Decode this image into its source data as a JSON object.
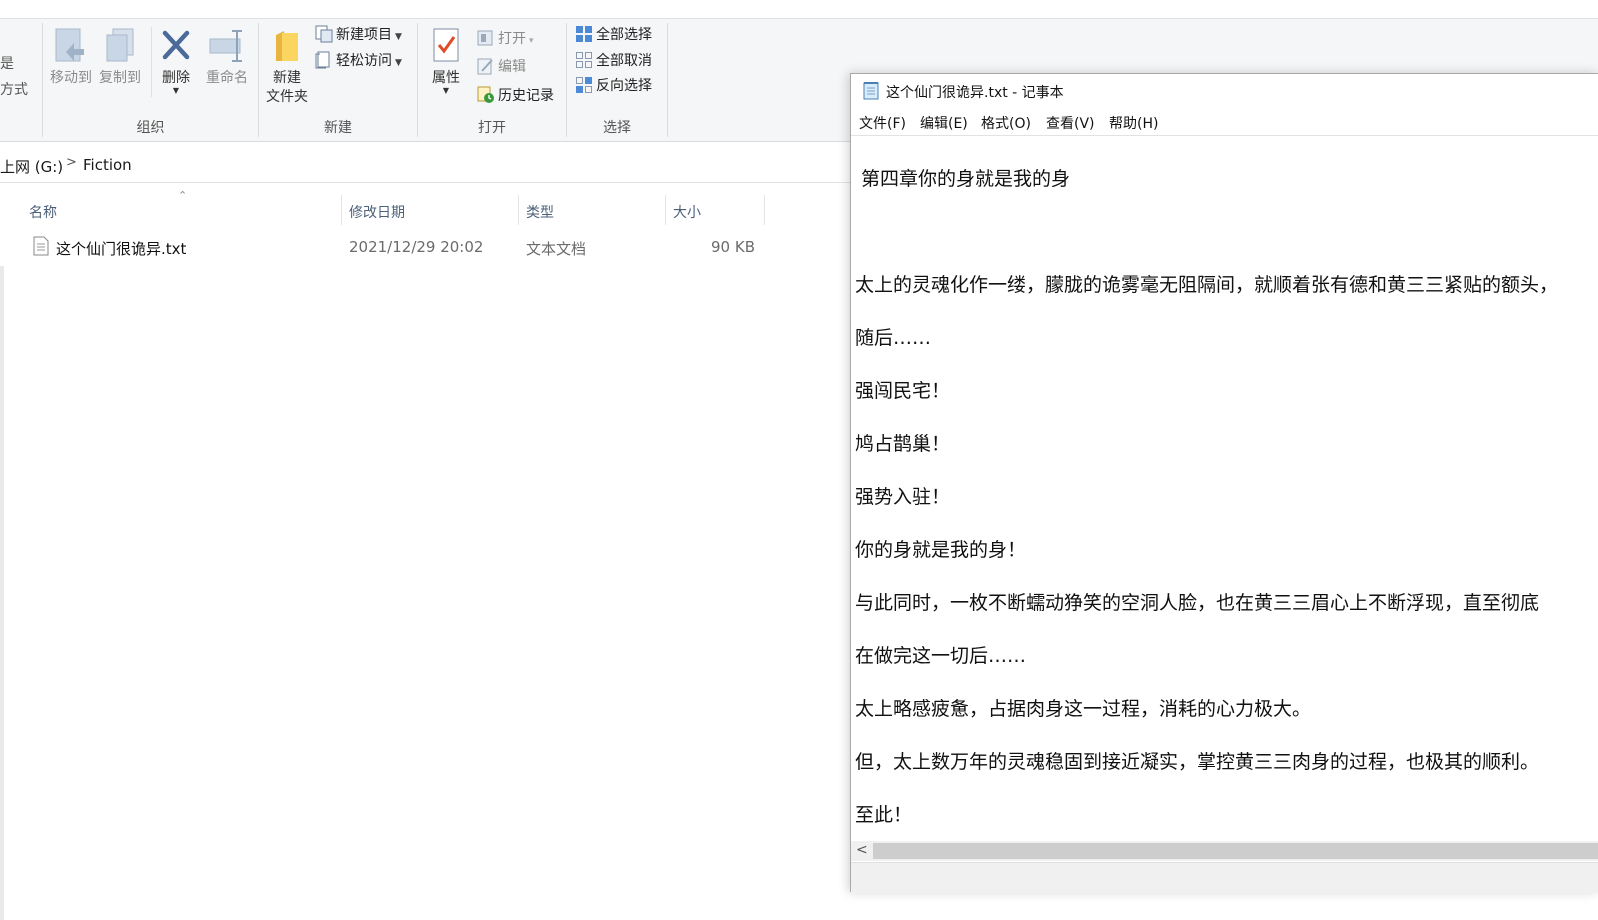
{
  "ribbon": {
    "left_partial_top": "是",
    "left_partial_label": "方式",
    "organize": {
      "label": "组织",
      "move_to": "移动到",
      "copy_to": "复制到",
      "delete": "删除",
      "rename": "重命名"
    },
    "new": {
      "label": "新建",
      "new_folder_line1": "新建",
      "new_folder_line2": "文件夹",
      "new_item": "新建项目",
      "easy_access": "轻松访问"
    },
    "open": {
      "label": "打开",
      "properties": "属性",
      "open": "打开",
      "edit": "编辑",
      "history": "历史记录"
    },
    "select": {
      "label": "选择",
      "select_all": "全部选择",
      "select_none": "全部取消",
      "invert": "反向选择"
    }
  },
  "address": {
    "drive": "上网 (G:)",
    "separator": ">",
    "folder": "Fiction"
  },
  "file_list": {
    "columns": [
      "名称",
      "修改日期",
      "类型",
      "大小"
    ],
    "rows": [
      {
        "name": "这个仙门很诡异.txt",
        "modified": "2021/12/29 20:02",
        "type": "文本文档",
        "size": "90 KB"
      }
    ]
  },
  "notepad": {
    "title": "这个仙门很诡异.txt - 记事本",
    "menu": [
      "文件(F)",
      "编辑(E)",
      "格式(O)",
      "查看(V)",
      "帮助(H)"
    ],
    "lines": [
      "第四章你的身就是我的身",
      "太上的灵魂化作一缕，朦胧的诡雾毫无阻隔间，就顺着张有德和黄三三紧贴的额头，",
      "随后……",
      "强闯民宅！",
      "鸠占鹊巢！",
      "强势入驻！",
      "你的身就是我的身！",
      "与此同时，一枚不断蠕动狰笑的空洞人脸，也在黄三三眉心上不断浮现，直至彻底",
      "在做完这一切后……",
      "太上略感疲惫，占据肉身这一过程，消耗的心力极大。",
      "但，太上数万年的灵魂稳固到接近凝实，掌控黄三三肉身的过程，也极其的顺利。",
      "至此！"
    ],
    "scroll_left_arrow": "<"
  }
}
